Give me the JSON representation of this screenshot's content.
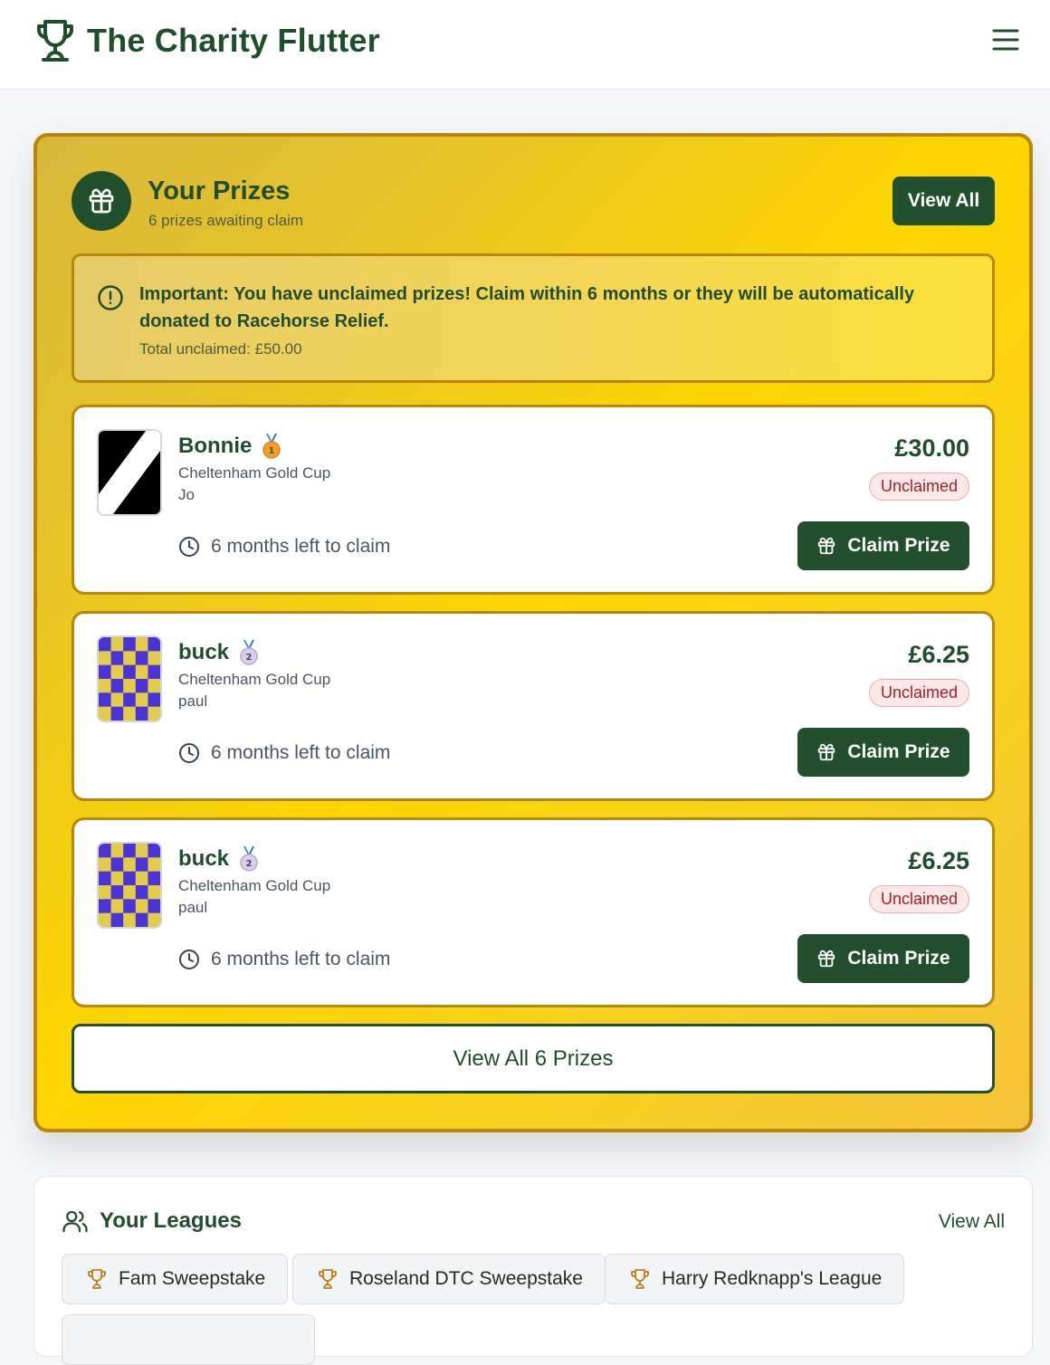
{
  "header": {
    "brand_title": "The Charity Flutter",
    "brand_icon": "trophy-icon",
    "menu_icon": "hamburger-menu-icon"
  },
  "prizes": {
    "title": "Your Prizes",
    "subtitle": "6 prizes awaiting claim",
    "view_all_label": "View All",
    "warning": {
      "message": "Important: You have unclaimed prizes! Claim within 6 months or they will be automatically donated to Racehorse Relief.",
      "total": "Total unclaimed: £50.00"
    },
    "items": [
      {
        "horse": "Bonnie",
        "medal": "1",
        "race": "Cheltenham Gold Cup",
        "owner": "Jo",
        "time_left": "6 months left to claim",
        "amount": "£30.00",
        "status": "Unclaimed",
        "claim_label": "Claim Prize",
        "silk": "black-white-diagonal"
      },
      {
        "horse": "buck",
        "medal": "2",
        "race": "Cheltenham Gold Cup",
        "owner": "paul",
        "time_left": "6 months left to claim",
        "amount": "£6.25",
        "status": "Unclaimed",
        "claim_label": "Claim Prize",
        "silk": "yellow-blue-check"
      },
      {
        "horse": "buck",
        "medal": "2",
        "race": "Cheltenham Gold Cup",
        "owner": "paul",
        "time_left": "6 months left to claim",
        "amount": "£6.25",
        "status": "Unclaimed",
        "claim_label": "Claim Prize",
        "silk": "yellow-blue-check"
      }
    ],
    "view_all_prizes_label": "View All 6 Prizes"
  },
  "leagues": {
    "title": "Your Leagues",
    "view_all_label": "View All",
    "items": [
      {
        "name": "Fam Sweepstake"
      },
      {
        "name": "Roseland DTC Sweepstake"
      },
      {
        "name": "Harry Redknapp's League"
      }
    ]
  },
  "colors": {
    "brand_green": "#22502f",
    "gold_border": "#b8860b",
    "gold": "#fcd500",
    "badge_red": "#a3202a"
  }
}
